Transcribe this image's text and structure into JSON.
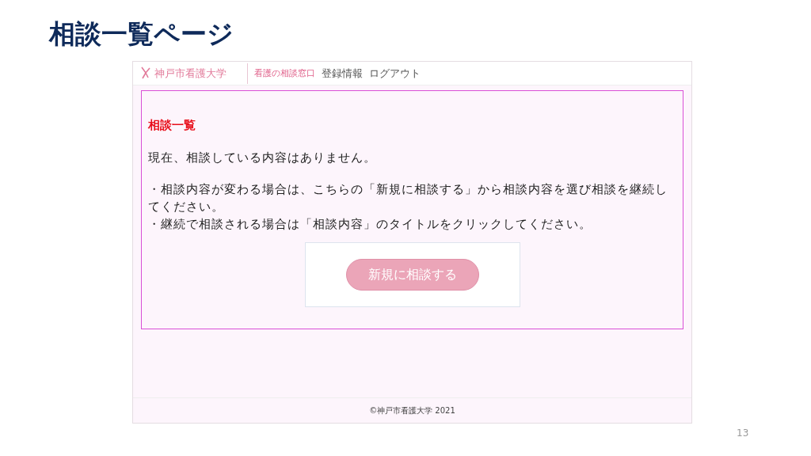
{
  "slide_title": "相談一覧ページ",
  "site": {
    "logo": "神戸市看護大学",
    "service": "看護の相談窓口",
    "nav": [
      "登録情報",
      "ログアウト"
    ]
  },
  "content": {
    "heading": "相談一覧",
    "message": "現在、相談している内容はありません。",
    "notes": [
      "・相談内容が変わる場合は、こちらの「新規に相談する」から相談内容を選び相談を継続してください。",
      "・継続で相談される場合は「相談内容」のタイトルをクリックしてください。"
    ],
    "button": "新規に相談する"
  },
  "footer": "©神戸市看護大学 2021",
  "page_number": "13"
}
